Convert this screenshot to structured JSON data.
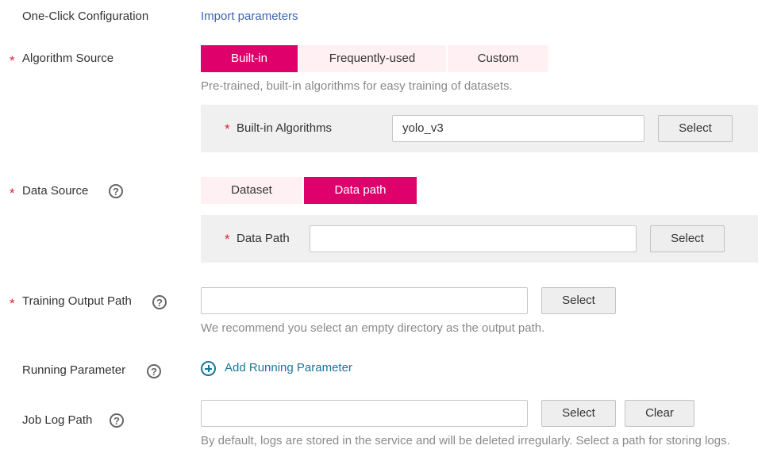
{
  "one_click": {
    "label": "One-Click Configuration",
    "link": "Import parameters"
  },
  "algorithm_source": {
    "label": "Algorithm Source",
    "tabs": [
      "Built-in",
      "Frequently-used",
      "Custom"
    ],
    "active_tab": "Built-in",
    "hint": "Pre-trained, built-in algorithms for easy training of datasets.",
    "builtin_label": "Built-in Algorithms",
    "builtin_value": "yolo_v3",
    "select_label": "Select"
  },
  "data_source": {
    "label": "Data Source",
    "tabs": [
      "Dataset",
      "Data path"
    ],
    "active_tab": "Data path",
    "data_path_label": "Data Path",
    "data_path_value": "",
    "select_label": "Select"
  },
  "training_output": {
    "label": "Training Output Path",
    "value": "",
    "select_label": "Select",
    "hint": "We recommend you select an empty directory as the output path."
  },
  "running_parameter": {
    "label": "Running Parameter",
    "add_label": "Add Running Parameter"
  },
  "job_log": {
    "label": "Job Log Path",
    "value": "",
    "select_label": "Select",
    "clear_label": "Clear",
    "hint": "By default, logs are stored in the service and will be deleted irregularly. Select a path for storing logs."
  },
  "required_marker": "*",
  "help_glyph": "?",
  "colors": {
    "accent": "#e0006c",
    "tab_inactive_bg": "#fff0f4",
    "required": "#e0213a",
    "link": "#3a63b8",
    "add_link": "#16779a"
  }
}
